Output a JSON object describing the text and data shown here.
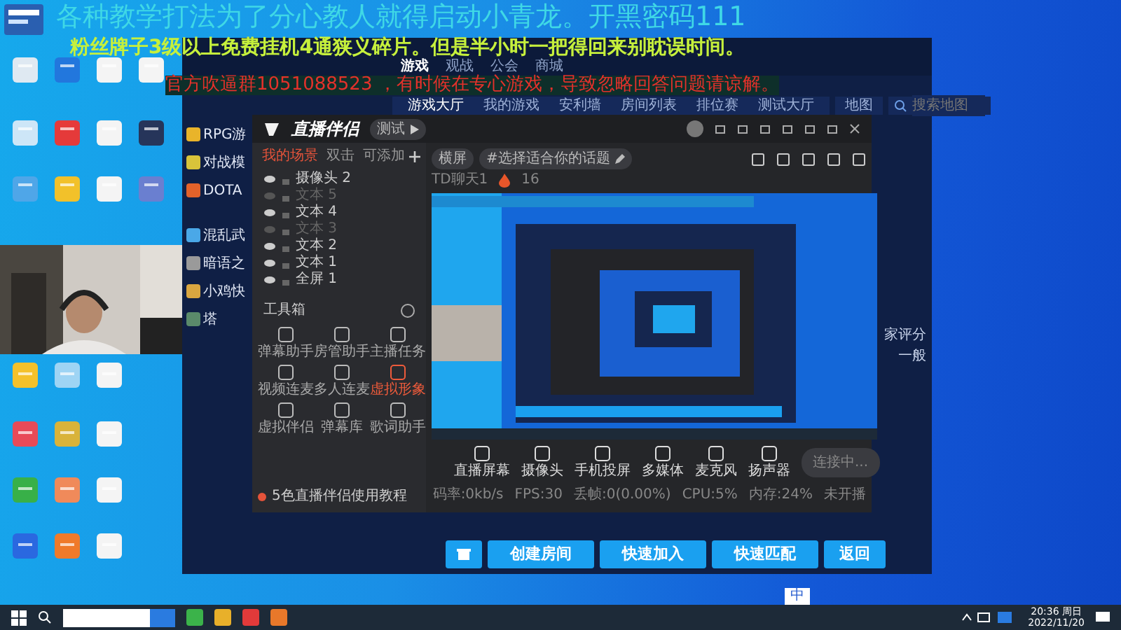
{
  "overlay_lines": [
    "各种教学打法为了分心教人就得启动小青龙。开黑密码111",
    "粉丝牌子3级以上免费挂机4通狭义碎片。但是半小时一把得回来别耽误时间。",
    "官方吹逼群1051088523 ，有时候在专心游戏，导致忽略回答问题请谅解。"
  ],
  "game_window": {
    "top_tabs": [
      {
        "label": "游戏",
        "selected": true
      },
      {
        "label": "观战",
        "selected": false
      },
      {
        "label": "公会",
        "selected": false
      },
      {
        "label": "商城",
        "selected": false
      }
    ],
    "sub_tabs": [
      {
        "label": "游戏大厅",
        "selected": true
      },
      {
        "label": "我的游戏",
        "selected": false
      },
      {
        "label": "安利墙",
        "selected": false
      },
      {
        "label": "房间列表",
        "selected": false
      },
      {
        "label": "排位赛",
        "selected": false
      },
      {
        "label": "测试大厅",
        "selected": false
      }
    ],
    "map_filter": "地图",
    "search_placeholder": "搜索地图",
    "sidebar": [
      {
        "label": "RPG游",
        "color": "#e9b42a"
      },
      {
        "label": "对战模",
        "color": "#d8c33a"
      },
      {
        "label": "DOTA",
        "color": "#e2622a"
      },
      {
        "label": "混乱武",
        "color": "#4aa8e8"
      },
      {
        "label": "暗语之",
        "color": "#9a9a9a"
      },
      {
        "label": "小鸡快",
        "color": "#d9a640"
      },
      {
        "label": "塔",
        "color": "#5a8a6a"
      }
    ],
    "side_notes": [
      "家评分",
      "一般"
    ],
    "buttons": [
      "创建房间",
      "快速加入",
      "快速匹配",
      "返回"
    ]
  },
  "stream_app": {
    "title": "直播伴侣",
    "badge": "测试",
    "panel_tabs": [
      {
        "label": "我的场景",
        "selected": true
      },
      {
        "label": "双击",
        "selected": false
      },
      {
        "label": "可添加",
        "selected": false
      }
    ],
    "sources": [
      {
        "name": "摄像头 2",
        "visible": true
      },
      {
        "name": "文本 5",
        "visible": false
      },
      {
        "name": "文本 4",
        "visible": true
      },
      {
        "name": "文本 3",
        "visible": false
      },
      {
        "name": "文本 2",
        "visible": true
      },
      {
        "name": "文本 1",
        "visible": true
      },
      {
        "name": "全屏 1",
        "visible": true
      }
    ],
    "toolbox_title": "工具箱",
    "tools": [
      {
        "label": "弹幕助手",
        "active": false
      },
      {
        "label": "房管助手",
        "active": false
      },
      {
        "label": "主播任务",
        "active": false
      },
      {
        "label": "视频连麦",
        "active": false
      },
      {
        "label": "多人连麦",
        "active": false
      },
      {
        "label": "虚拟形象",
        "active": true
      },
      {
        "label": "虚拟伴侣",
        "active": false
      },
      {
        "label": "弹幕库",
        "active": false
      },
      {
        "label": "歌词助手",
        "active": false
      }
    ],
    "tutorial": "5色直播伴侣使用教程",
    "orientation": "横屏",
    "topic": "#选择适合你的话题",
    "channel": "TD聊天1",
    "heat": "16",
    "controls": [
      "直播屏幕",
      "摄像头",
      "手机投屏",
      "多媒体",
      "麦克风",
      "扬声器"
    ],
    "start_button": "连接中...",
    "stats": [
      "码率:0kb/s",
      "FPS:30",
      "丢帧:0(0.00%)",
      "CPU:5%",
      "内存:24%",
      "未开播"
    ]
  },
  "taskbar": {
    "ime": "中",
    "time": "20:36 周日",
    "date": "2022/11/20"
  }
}
